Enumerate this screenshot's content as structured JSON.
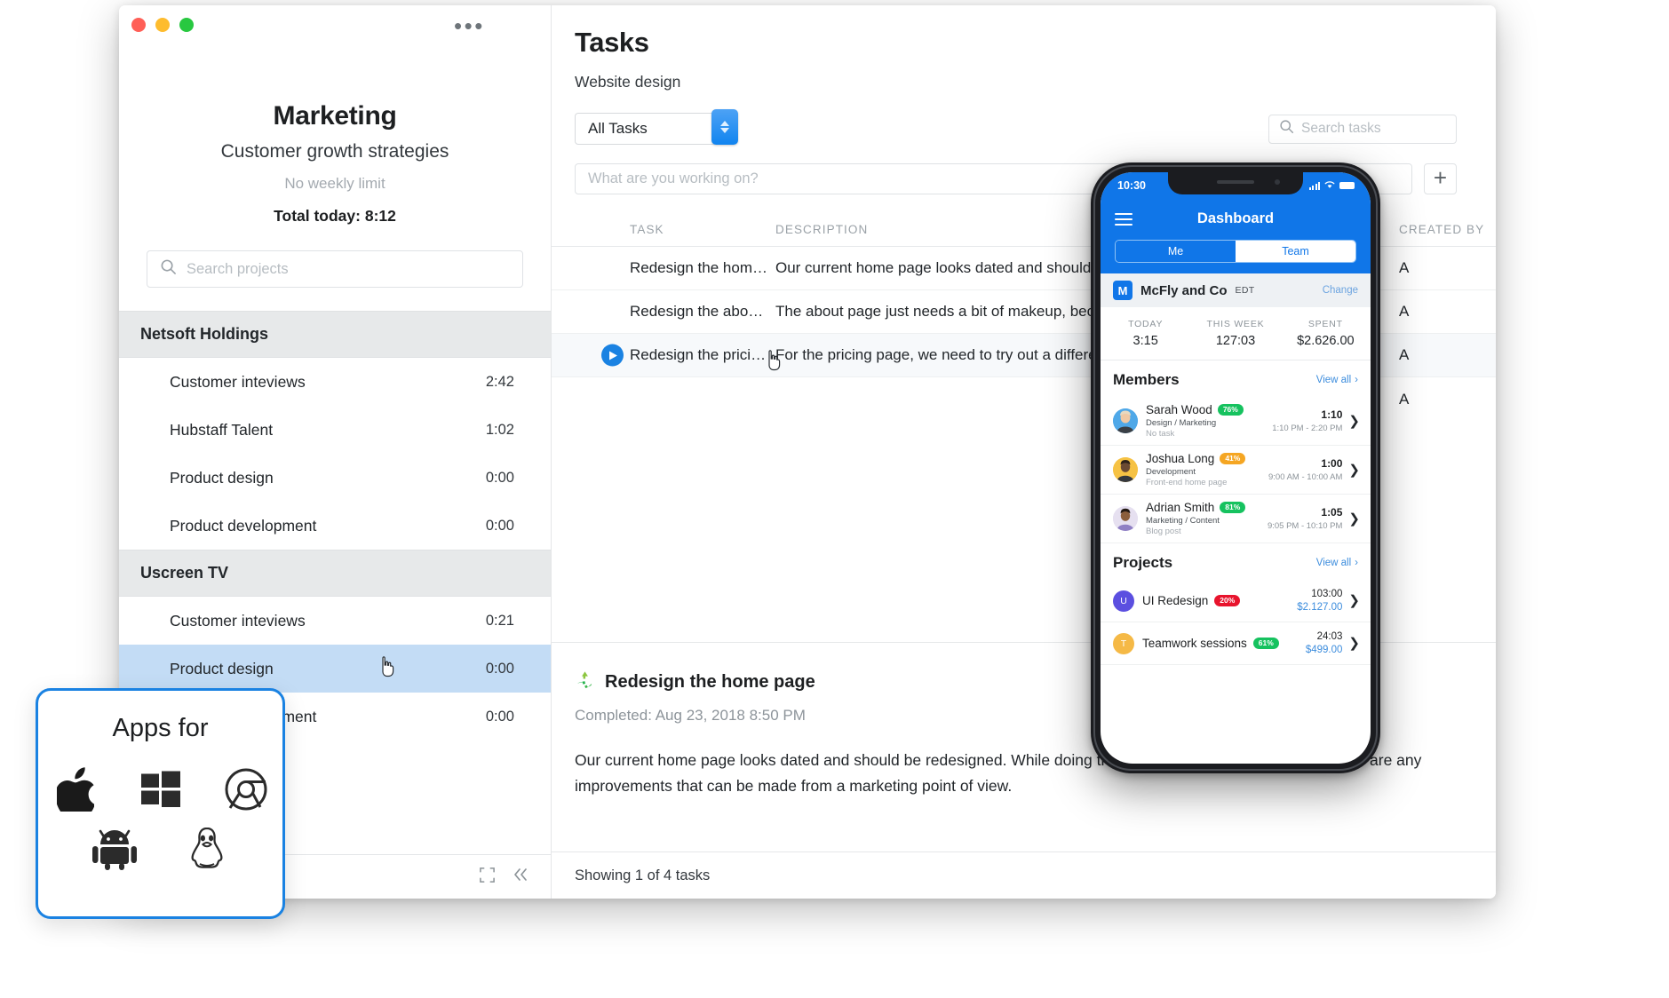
{
  "desktop": {
    "sidebar": {
      "project_title": "Marketing",
      "project_subtitle": "Customer growth strategies",
      "weekly_limit": "No weekly limit",
      "total_today": "Total today: 8:12",
      "search_placeholder": "Search projects",
      "search_value": "",
      "groups": [
        {
          "name": "Netsoft Holdings",
          "projects": [
            {
              "label": "Customer inteviews",
              "time": "2:42",
              "selected": false
            },
            {
              "label": "Hubstaff Talent",
              "time": "1:02",
              "selected": false
            },
            {
              "label": "Product design",
              "time": "0:00",
              "selected": false
            },
            {
              "label": "Product development",
              "time": "0:00",
              "selected": false
            }
          ]
        },
        {
          "name": "Uscreen TV",
          "projects": [
            {
              "label": "Customer inteviews",
              "time": "0:21",
              "selected": false
            },
            {
              "label": "Product design",
              "time": "0:00",
              "selected": true
            },
            {
              "label": "Product development",
              "time": "0:00",
              "selected": false
            }
          ]
        }
      ]
    },
    "main": {
      "title": "Tasks",
      "subtitle": "Website design",
      "filter_selected": "All Tasks",
      "search_placeholder": "Search tasks",
      "search_value": "",
      "new_task_placeholder": "What are you working on?",
      "new_task_value": "",
      "add_button_label": "+",
      "columns": [
        "TASK",
        "DESCRIPTION",
        "CREATED BY"
      ],
      "rows": [
        {
          "task": "Redesign the home page",
          "description": "Our current home page looks dated and should…",
          "created_by": "A",
          "running": false
        },
        {
          "task": "Redesign the about page",
          "description": "The about page just needs a bit of makeup, bec…",
          "created_by": "A",
          "running": false
        },
        {
          "task": "Redesign the pricing page",
          "description": "For the pricing page, we need to try out a differe…",
          "created_by": "A",
          "running": true
        },
        {
          "task": "",
          "description": "",
          "created_by": "A",
          "running": false
        }
      ],
      "detail": {
        "title": "Redesign the home page",
        "completed": "Completed: Aug 23, 2018 8:50 PM",
        "body": "Our current home page looks dated and should be redesigned. While doing this we can take a look and see if there are any improvements that can be made from a marketing point of view."
      },
      "footer": "Showing 1 of 4 tasks"
    }
  },
  "phone": {
    "status_time": "10:30",
    "app_title": "Dashboard",
    "tabs": [
      {
        "label": "Me",
        "active": true
      },
      {
        "label": "Team",
        "active": false
      }
    ],
    "org": {
      "initial": "M",
      "name": "McFly and Co",
      "timezone": "EDT",
      "change_label": "Change"
    },
    "stats": [
      {
        "key": "TODAY",
        "value": "3:15"
      },
      {
        "key": "THIS WEEK",
        "value": "127:03"
      },
      {
        "key": "SPENT",
        "value": "$2.626.00"
      }
    ],
    "members_section": {
      "title": "Members",
      "view_all": "View all"
    },
    "members": [
      {
        "name": "Sarah Wood",
        "percent": "76%",
        "percent_color": "#16c25f",
        "role": "Design / Marketing",
        "task": "No task",
        "time": "1:10",
        "span": "1:10 PM - 2:20 PM",
        "avatar_color": "#4fa8e8"
      },
      {
        "name": "Joshua Long",
        "percent": "41%",
        "percent_color": "#f5a623",
        "role": "Development",
        "task": "Front-end home page",
        "time": "1:00",
        "span": "9:00 AM - 10:00 AM",
        "avatar_color": "#f6c244"
      },
      {
        "name": "Adrian Smith",
        "percent": "81%",
        "percent_color": "#16c25f",
        "role": "Marketing / Content",
        "task": "Blog post",
        "time": "1:05",
        "span": "9:05 PM - 10:10 PM",
        "avatar_color": "#ded6ef"
      }
    ],
    "projects_section": {
      "title": "Projects",
      "view_all": "View all"
    },
    "projects": [
      {
        "initial": "U",
        "name": "UI Redesign",
        "percent": "20%",
        "percent_color": "#e8142d",
        "avatar_color": "#5b4fe0",
        "time": "103:00",
        "money": "$2.127.00"
      },
      {
        "initial": "T",
        "name": "Teamwork sessions",
        "percent": "61%",
        "percent_color": "#16c25f",
        "avatar_color": "#f5b councils",
        "time": "24:03",
        "money": "$499.00"
      }
    ]
  },
  "apps_card": {
    "title": "Apps for",
    "icons": [
      "apple-icon",
      "windows-icon",
      "chrome-icon",
      "android-icon",
      "linux-icon"
    ]
  }
}
